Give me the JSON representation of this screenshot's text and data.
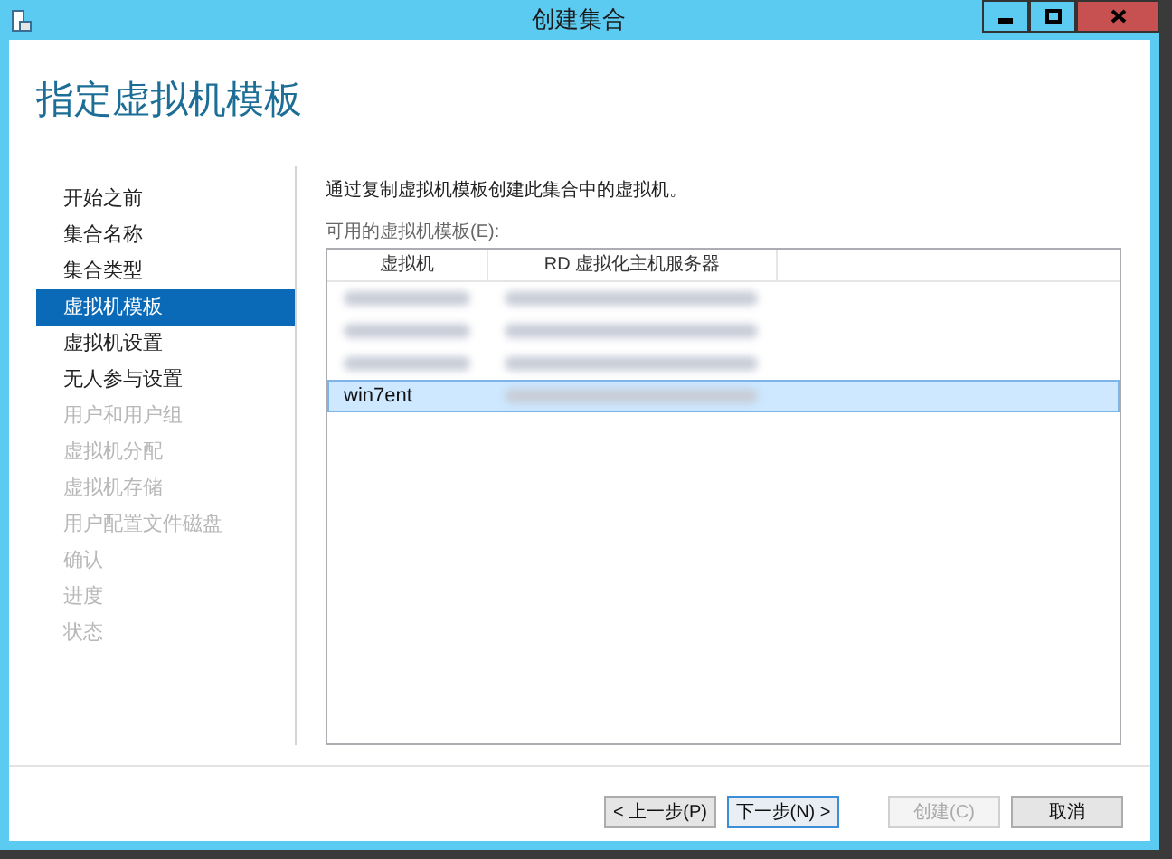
{
  "window": {
    "title": "创建集合"
  },
  "heading": "指定虚拟机模板",
  "nav": [
    {
      "label": "开始之前",
      "selected": false,
      "disabled": false
    },
    {
      "label": "集合名称",
      "selected": false,
      "disabled": false
    },
    {
      "label": "集合类型",
      "selected": false,
      "disabled": false
    },
    {
      "label": "虚拟机模板",
      "selected": true,
      "disabled": false
    },
    {
      "label": "虚拟机设置",
      "selected": false,
      "disabled": false
    },
    {
      "label": "无人参与设置",
      "selected": false,
      "disabled": false
    },
    {
      "label": "用户和用户组",
      "selected": false,
      "disabled": true
    },
    {
      "label": "虚拟机分配",
      "selected": false,
      "disabled": true
    },
    {
      "label": "虚拟机存储",
      "selected": false,
      "disabled": true
    },
    {
      "label": "用户配置文件磁盘",
      "selected": false,
      "disabled": true
    },
    {
      "label": "确认",
      "selected": false,
      "disabled": true
    },
    {
      "label": "进度",
      "selected": false,
      "disabled": true
    },
    {
      "label": "状态",
      "selected": false,
      "disabled": true
    }
  ],
  "description": "通过复制虚拟机模板创建此集合中的虚拟机。",
  "table": {
    "label": "可用的虚拟机模板(E):",
    "columns": [
      "虚拟机",
      "RD 虚拟化主机服务器"
    ],
    "rows": [
      {
        "selected": false,
        "cells": [
          {
            "kind": "blurred"
          },
          {
            "kind": "blurred"
          }
        ]
      },
      {
        "selected": false,
        "cells": [
          {
            "kind": "blurred"
          },
          {
            "kind": "blurred"
          }
        ]
      },
      {
        "selected": false,
        "cells": [
          {
            "kind": "blurred"
          },
          {
            "kind": "blurred"
          }
        ]
      },
      {
        "selected": true,
        "cells": [
          {
            "kind": "text",
            "text": "win7ent"
          },
          {
            "kind": "blurred"
          }
        ]
      }
    ]
  },
  "buttons": [
    {
      "label": "< 上一步(P)",
      "disabled": false,
      "focused": false
    },
    {
      "label": "下一步(N) >",
      "disabled": false,
      "focused": true
    },
    {
      "label": "创建(C)",
      "disabled": true,
      "focused": false
    },
    {
      "label": "取消",
      "disabled": false,
      "focused": false
    }
  ]
}
